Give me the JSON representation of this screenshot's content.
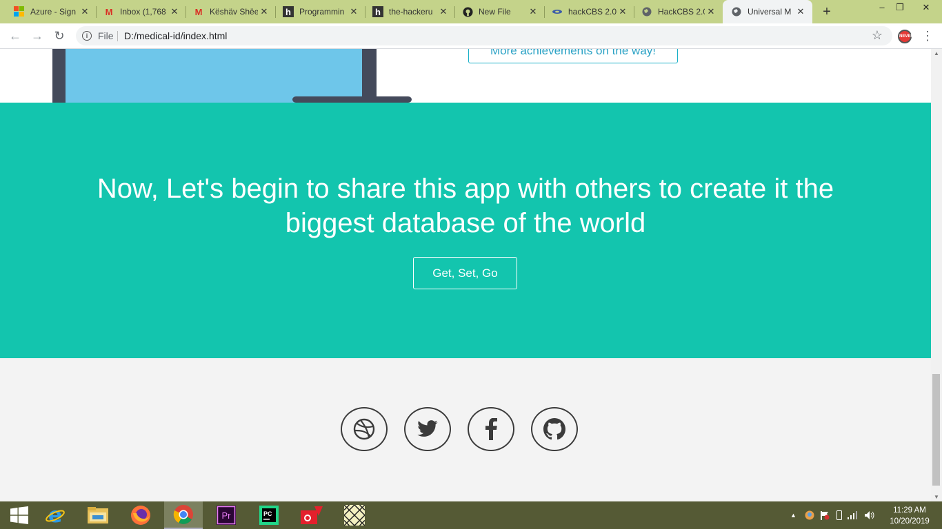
{
  "browser": {
    "tabs": [
      {
        "title": "Azure - Sign",
        "icon": "microsoft-icon"
      },
      {
        "title": "Inbox (1,768",
        "icon": "gmail-icon"
      },
      {
        "title": "Këshäv Shëe",
        "icon": "gmail-icon"
      },
      {
        "title": "Programmin",
        "icon": "hackernoon-icon"
      },
      {
        "title": "the-hackeru",
        "icon": "hackernoon-icon"
      },
      {
        "title": "New File",
        "icon": "github-icon"
      },
      {
        "title": "hackCBS 2.0",
        "icon": "hackcbs-icon"
      },
      {
        "title": "HackCBS 2.0",
        "icon": "globe-icon"
      },
      {
        "title": "Universal M",
        "icon": "globe-icon",
        "active": true
      }
    ],
    "new_tab": "+",
    "window_controls": {
      "minimize": "–",
      "restore": "❐",
      "close": "✕"
    },
    "nav": {
      "back": "←",
      "forward": "→",
      "reload": "↻"
    },
    "address": {
      "scheme": "File",
      "url": "D:/medical-id/index.html"
    },
    "star": "☆",
    "menu": "⋮"
  },
  "page": {
    "achievements_button": "More achievements on the way!",
    "cta": {
      "title": "Now, Let's begin to share this app with others to create it the biggest database of the world",
      "button": "Get, Set, Go"
    },
    "social": [
      "dribbble-icon",
      "twitter-icon",
      "facebook-icon",
      "github-icon"
    ],
    "colors": {
      "cta_bg": "#13c5ae",
      "footer_bg": "#f3f3f3",
      "monitor_screen": "#6ec6ea",
      "monitor_frame": "#444a5b"
    }
  },
  "taskbar": {
    "apps": [
      "start-icon",
      "internet-explorer-icon",
      "file-explorer-icon",
      "firefox-icon",
      "chrome-icon",
      "premiere-pro-icon",
      "pycharm-icon",
      "camera-app-icon",
      "pattern-app-icon"
    ],
    "clock": {
      "time": "11:29 AM",
      "date": "10/20/2019"
    }
  }
}
